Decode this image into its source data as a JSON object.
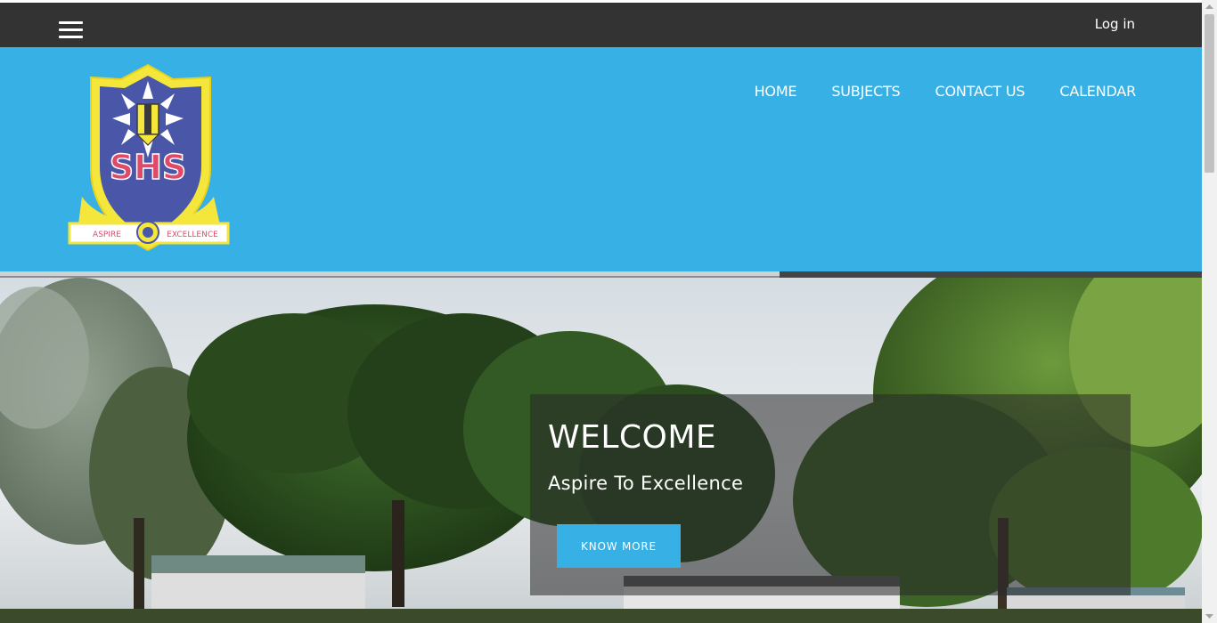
{
  "topbar": {
    "menu_icon": "hamburger-menu-icon",
    "login_label": "Log in"
  },
  "header": {
    "logo": {
      "letters": "SHS",
      "motto_left": "ASPIRE",
      "motto_right": "EXCELLENCE"
    },
    "nav": [
      "HOME",
      "SUBJECTS",
      "CONTACT US",
      "CALENDAR"
    ]
  },
  "hero": {
    "title": "WELCOME",
    "subtitle": "Aspire To Excellence",
    "button_label": "KNOW MORE"
  },
  "colors": {
    "topbar": "#333333",
    "header": "#37b0e5",
    "accent": "#37b0e5"
  }
}
